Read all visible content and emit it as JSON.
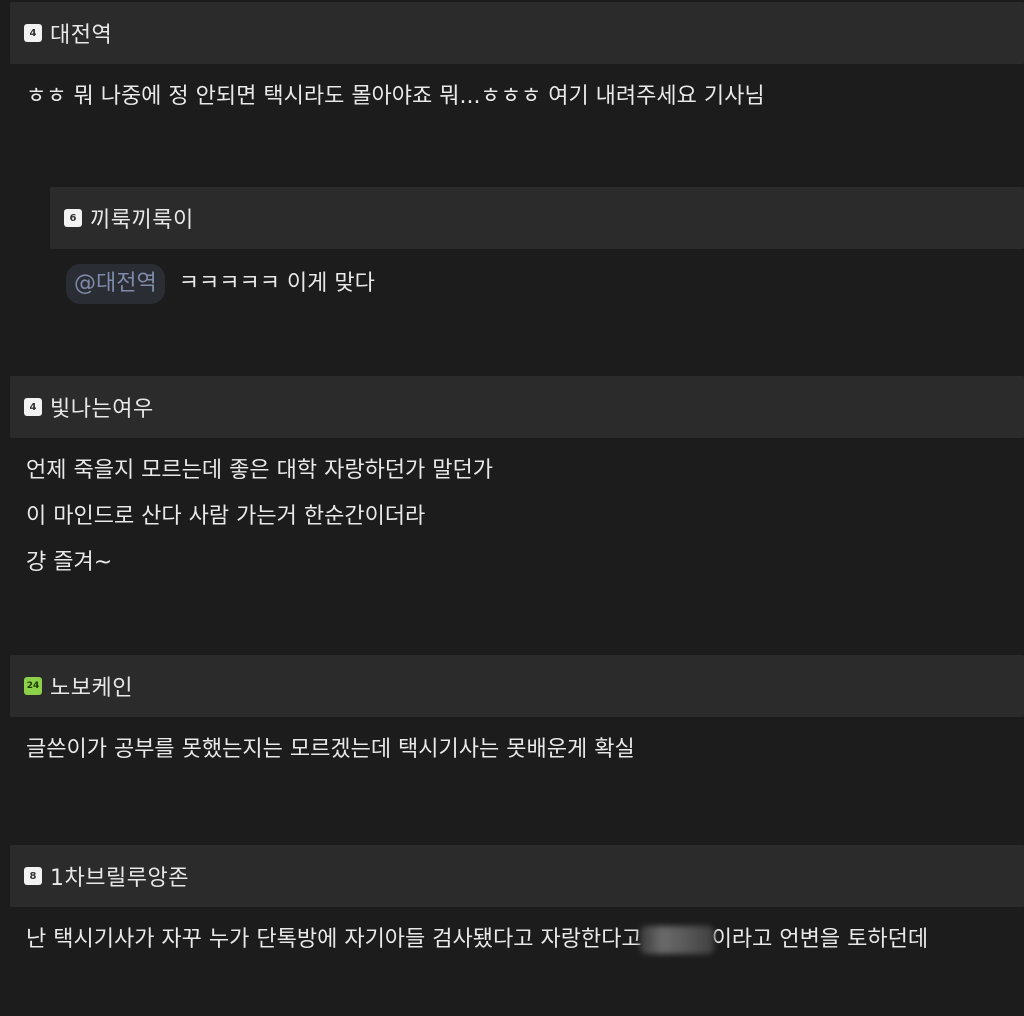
{
  "comments": [
    {
      "level": "4",
      "nickname": "대전역",
      "lines": [
        "ㅎㅎ 뭐 나중에 정 안되면 택시라도 몰아야죠 뭐...ㅎㅎㅎ 여기 내려주세요 기사님"
      ]
    },
    {
      "level": "6",
      "nickname": "끼룩끼룩이",
      "mention": "@대전역",
      "lines": [
        "ㅋㅋㅋㅋㅋ 이게 맞다"
      ]
    },
    {
      "level": "4",
      "nickname": "빛나는여우",
      "lines": [
        "언제 죽을지 모르는데 좋은 대학 자랑하던가 말던가",
        "이 마인드로 산다 사람 가는거 한순간이더라",
        "걍 즐겨~"
      ]
    },
    {
      "level": "24",
      "nickname": "노보케인",
      "lines": [
        "글쓴이가 공부를 못했는지는 모르겠는데 택시기사는 못배운게 확실"
      ]
    },
    {
      "level": "8",
      "nickname": "1차브릴루앙존",
      "line_before_blur": "난 택시기사가 자꾸 누가 단톡방에 자기아들 검사됐다고 자랑한다고",
      "line_after_blur": "이라고 언변을 토하던데"
    }
  ],
  "colors": {
    "background": "#1c1c1c",
    "header": "#2b2b2c",
    "text": "#e9e9e9",
    "mention_text": "#7f8aa8",
    "badge_green": "#8dd04a"
  }
}
